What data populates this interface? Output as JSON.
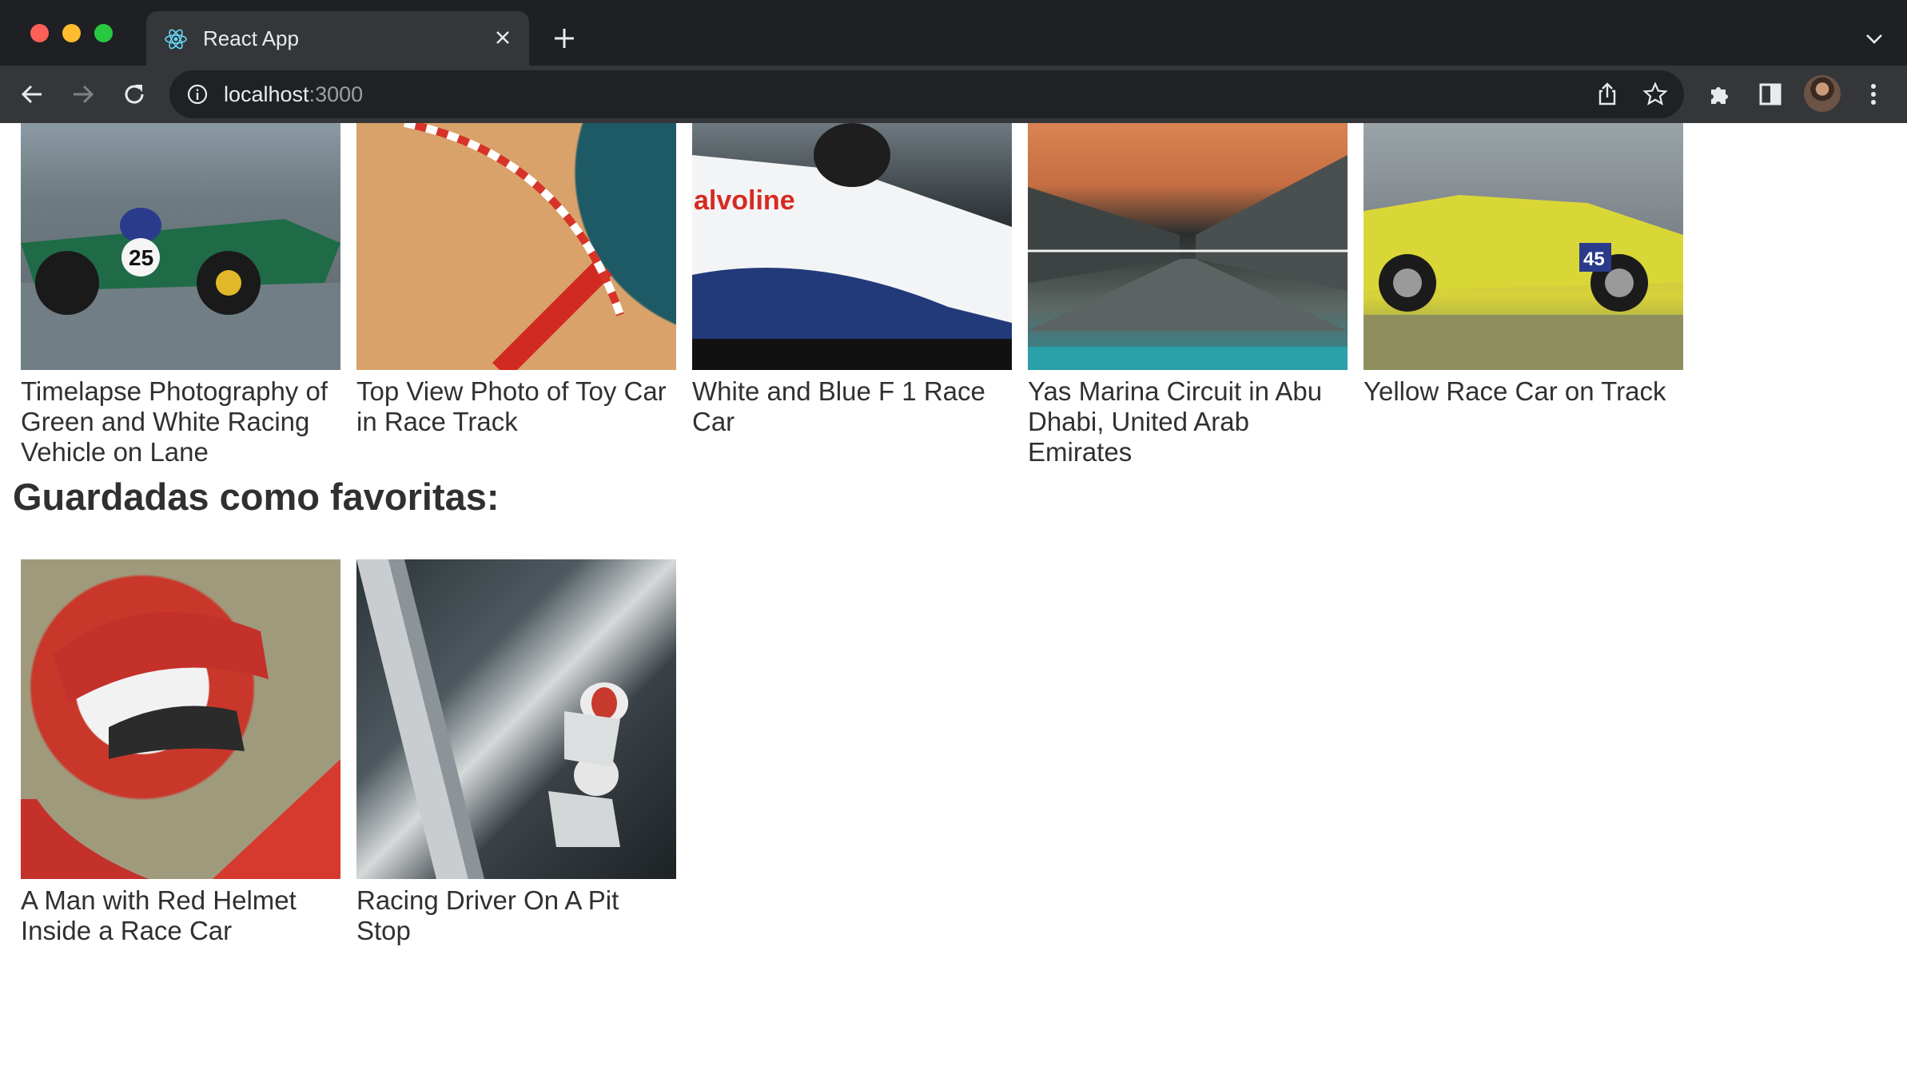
{
  "browser": {
    "tab_title": "React App",
    "url_host": "localhost",
    "url_port": ":3000"
  },
  "gallery": {
    "top_row": [
      {
        "caption": "Timelapse Photography of Green and White Racing Vehicle on Lane"
      },
      {
        "caption": "Top View Photo of Toy Car in Race Track"
      },
      {
        "caption": "White and Blue F 1 Race Car"
      },
      {
        "caption": "Yas Marina Circuit in Abu Dhabi, United Arab Emirates"
      },
      {
        "caption": "Yellow Race Car on Track"
      }
    ]
  },
  "favorites": {
    "title": "Guardadas como favoritas:",
    "items": [
      {
        "caption": "A Man with Red Helmet Inside a Race Car"
      },
      {
        "caption": "Racing Driver On A Pit Stop"
      }
    ]
  },
  "colors": {
    "chrome_dark": "#1f2023",
    "toolbar": "#35363a",
    "text": "#303030"
  }
}
